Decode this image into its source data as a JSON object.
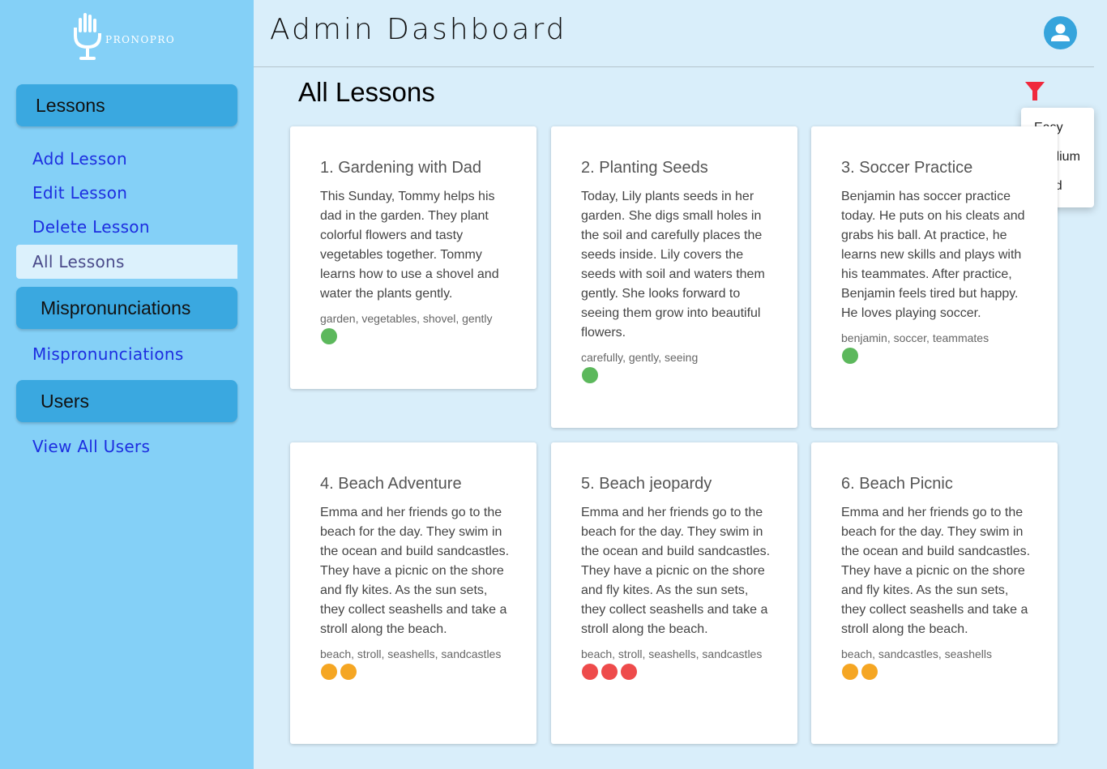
{
  "brand": {
    "name": "PRONOPRO"
  },
  "header": {
    "title": "Admin Dashboard"
  },
  "icons": {
    "logo": "microphone-hand-icon",
    "avatar": "user-icon",
    "filter": "funnel-icon"
  },
  "colors": {
    "sidebar": "#84d0f7",
    "sidebar_header": "#3aa8e0",
    "link": "#1d2ee0",
    "filter": "#f0283c",
    "easy": "#5cb85c",
    "medium": "#f5a623",
    "hard": "#ee4b4b"
  },
  "sidebar": {
    "sections": [
      {
        "label": "Lessons",
        "links": [
          "Add Lesson",
          "Edit Lesson",
          "Delete Lesson",
          "All Lessons"
        ]
      },
      {
        "label": "Mispronunciations",
        "links": [
          "Mispronunciations"
        ]
      },
      {
        "label": "Users",
        "links": [
          "View All Users"
        ]
      }
    ],
    "active_link": "All Lessons"
  },
  "main": {
    "title": "All Lessons",
    "filter_menu": [
      "Easy",
      "Medium",
      "Hard"
    ],
    "lessons": [
      {
        "title": "1. Gardening with Dad",
        "text": "This Sunday, Tommy helps his dad in the garden. They plant colorful flowers and tasty vegetables together. Tommy learns how to use a shovel and water the plants gently.",
        "tags": "garden, vegetables, shovel, gently",
        "difficulty": "easy",
        "level": 1
      },
      {
        "title": "2. Planting Seeds",
        "text": "Today, Lily plants seeds in her garden. She digs small holes in the soil and carefully places the seeds inside. Lily covers the seeds with soil and waters them gently. She looks forward to seeing them grow into beautiful flowers.",
        "tags": "carefully, gently, seeing",
        "difficulty": "easy",
        "level": 1
      },
      {
        "title": "3. Soccer Practice",
        "text": "Benjamin has soccer practice today. He puts on his cleats and grabs his ball. At practice, he learns new skills and plays with his teammates. After practice, Benjamin feels tired but happy. He loves playing soccer.",
        "tags": "benjamin, soccer, teammates",
        "difficulty": "easy",
        "level": 1
      },
      {
        "title": "4. Beach Adventure",
        "text": "Emma and her friends go to the beach for the day. They swim in the ocean and build sandcastles. They have a picnic on the shore and fly kites. As the sun sets, they collect seashells and take a stroll along the beach.",
        "tags": "beach, stroll, seashells, sandcastles",
        "difficulty": "medium",
        "level": 2
      },
      {
        "title": "5. Beach jeopardy",
        "text": "Emma and her friends go to the beach for the day. They swim in the ocean and build sandcastles. They have a picnic on the shore and fly kites. As the sun sets, they collect seashells and take a stroll along the beach.",
        "tags": "beach, stroll, seashells, sandcastles",
        "difficulty": "hard",
        "level": 3
      },
      {
        "title": "6. Beach Picnic",
        "text": "Emma and her friends go to the beach for the day. They swim in the ocean and build sandcastles. They have a picnic on the shore and fly kites. As the sun sets, they collect seashells and take a stroll along the beach.",
        "tags": "beach, sandcastles, seashells",
        "difficulty": "medium",
        "level": 2
      }
    ]
  }
}
